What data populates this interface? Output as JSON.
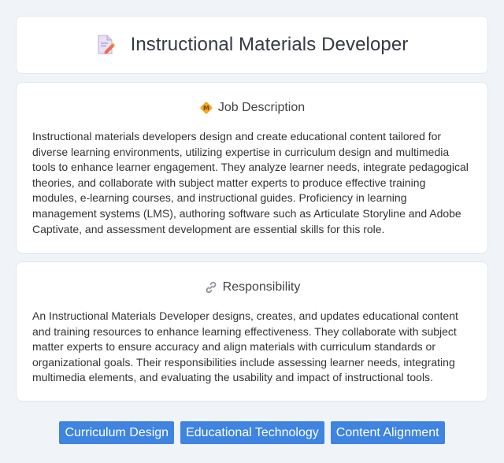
{
  "header": {
    "title": "Instructional Materials Developer",
    "icon": "document-edit-icon"
  },
  "sections": [
    {
      "icon": "diamond-badge-icon",
      "title": "Job Description",
      "body": "Instructional materials developers design and create educational content tailored for diverse learning environments, utilizing expertise in curriculum design and multimedia tools to enhance learner engagement. They analyze learner needs, integrate pedagogical theories, and collaborate with subject matter experts to produce effective training modules, e-learning courses, and instructional guides. Proficiency in learning management systems (LMS), authoring software such as Articulate Storyline and Adobe Captivate, and assessment development are essential skills for this role."
    },
    {
      "icon": "link-icon",
      "title": "Responsibility",
      "body": "An Instructional Materials Developer designs, creates, and updates educational content and training resources to enhance learning effectiveness. They collaborate with subject matter experts to ensure accuracy and align materials with curriculum standards or organizational goals. Their responsibilities include assessing learner needs, integrating multimedia elements, and evaluating the usability and impact of instructional tools."
    }
  ],
  "tags": [
    "Curriculum Design",
    "Educational Technology",
    "Content Alignment"
  ],
  "colors": {
    "background": "#f0f3f8",
    "card": "#ffffff",
    "tag": "#3e84e0",
    "accent_orange": "#f5a623"
  }
}
